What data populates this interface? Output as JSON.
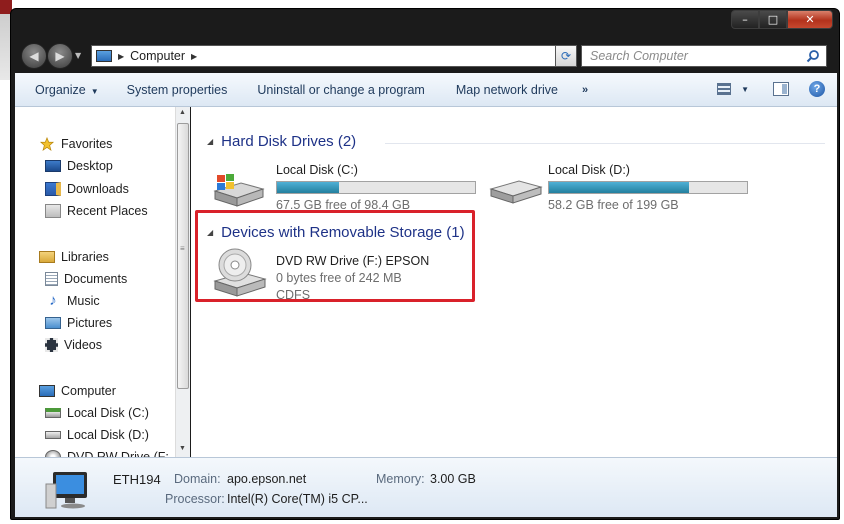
{
  "window": {
    "minimize_glyph": "–",
    "maximize_glyph": "□",
    "close_glyph": "✕"
  },
  "address": {
    "location": "Computer",
    "search_placeholder": "Search Computer"
  },
  "toolbar": {
    "organize": "Organize",
    "system_properties": "System properties",
    "uninstall": "Uninstall or change a program",
    "map_network_drive": "Map network drive",
    "more": "»"
  },
  "nav": {
    "favorites": "Favorites",
    "desktop": "Desktop",
    "downloads": "Downloads",
    "recent_places": "Recent Places",
    "libraries": "Libraries",
    "documents": "Documents",
    "music": "Music",
    "pictures": "Pictures",
    "videos": "Videos",
    "computer": "Computer",
    "local_disk_c": "Local Disk (C:)",
    "local_disk_d": "Local Disk (D:)",
    "dvd_drive": "DVD RW Drive (F:"
  },
  "content": {
    "hard_disk_header": "Hard Disk Drives (2)",
    "removable_header": "Devices with Removable Storage (1)",
    "drives": [
      {
        "name": "Local Disk (C:)",
        "free_text": "67.5 GB free of 98.4 GB",
        "used_fraction": 0.314
      },
      {
        "name": "Local Disk (D:)",
        "free_text": "58.2 GB free of 199 GB",
        "used_fraction": 0.708
      }
    ],
    "dvd": {
      "name": "DVD RW Drive (F:) EPSON",
      "free_text": "0 bytes free of 242 MB",
      "filesystem": "CDFS"
    }
  },
  "details": {
    "computer_name": "ETH194",
    "domain_label": "Domain:",
    "domain_value": "apo.epson.net",
    "memory_label": "Memory:",
    "memory_value": "3.00 GB",
    "processor_label": "Processor:",
    "processor_value": "Intel(R) Core(TM) i5 CP..."
  },
  "colors": {
    "highlight": "#d9212a",
    "bar_fill": "#2a9bc4",
    "group_header": "#1e3287"
  }
}
